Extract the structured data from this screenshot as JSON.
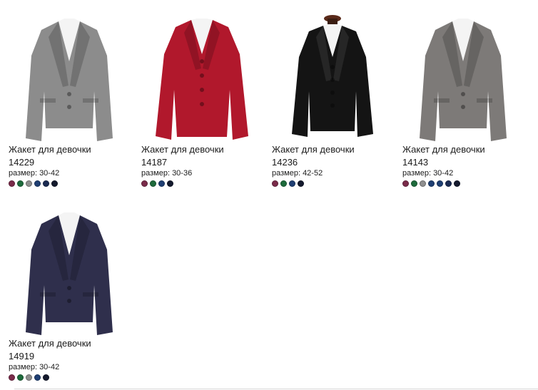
{
  "products": [
    {
      "title": "Жакет для девочки",
      "sku": "14229",
      "size": "размер: 30-42",
      "jacket_color": "#8c8c8c",
      "swatches": [
        "#7a2b4a",
        "#1e6b3c",
        "#8f8f8f",
        "#1f3f73",
        "#1a2a52",
        "#141a2e"
      ]
    },
    {
      "title": "Жакет для девочки",
      "sku": "14187",
      "size": "размер: 30-36",
      "jacket_color": "#b1182c",
      "swatches": [
        "#7a2b4a",
        "#1e6b3c",
        "#1f3f73",
        "#141a2e"
      ]
    },
    {
      "title": "Жакет для девочки",
      "sku": "14236",
      "size": "размер: 42-52",
      "jacket_color": "#141414",
      "swatches": [
        "#7a2b4a",
        "#1e6b3c",
        "#1f3f73",
        "#141a2e"
      ]
    },
    {
      "title": "Жакет для девочки",
      "sku": "14143",
      "size": "размер: 30-42",
      "jacket_color": "#7d7a78",
      "swatches": [
        "#7a2b4a",
        "#1e6b3c",
        "#8f8f8f",
        "#1f3f73",
        "#1f3f73",
        "#1a2a52",
        "#141a2e"
      ]
    },
    {
      "title": "Жакет для девочки",
      "sku": "14919",
      "size": "размер: 30-42",
      "jacket_color": "#2f2f4c",
      "swatches": [
        "#7a2b4a",
        "#1e6b3c",
        "#8f8f8f",
        "#1f3f73",
        "#141a2e"
      ]
    }
  ]
}
